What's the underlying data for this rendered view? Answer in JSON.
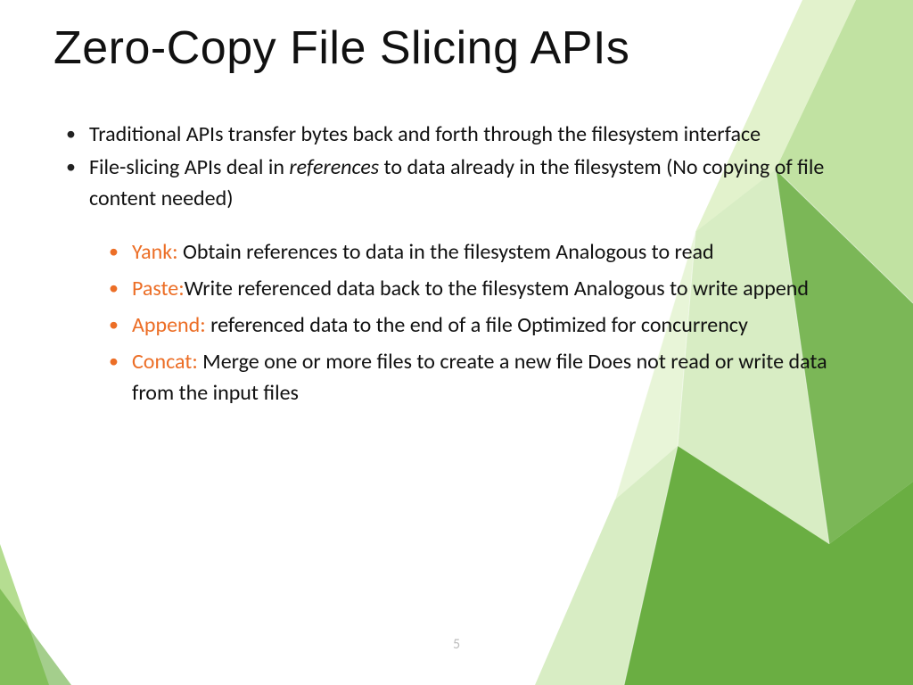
{
  "colors": {
    "accent": "#ec6e26",
    "green_dark": "#5aa52d",
    "green_mid": "#8ecb56",
    "green_light": "#bee38f"
  },
  "title": "Zero-Copy File Slicing APIs",
  "top_bullets": [
    {
      "text": "Traditional APIs transfer bytes back and forth through the filesystem interface"
    },
    {
      "pre": "File-slicing APIs deal in ",
      "em": "references",
      "post": " to data already in the filesystem (No copying of file content needed)"
    }
  ],
  "sub_bullets": [
    {
      "term": "Yank:",
      "desc": " Obtain references to data in the filesystem Analogous to read"
    },
    {
      "term": "Paste:",
      "desc": "Write referenced data back to the filesystem Analogous to write append"
    },
    {
      "term": "Append:",
      "desc": " referenced data to the end of a file Optimized for concurrency"
    },
    {
      "term": "Concat:",
      "desc": " Merge one or more files to create a new file Does not read or write data from the input files"
    }
  ],
  "page_number": "5"
}
